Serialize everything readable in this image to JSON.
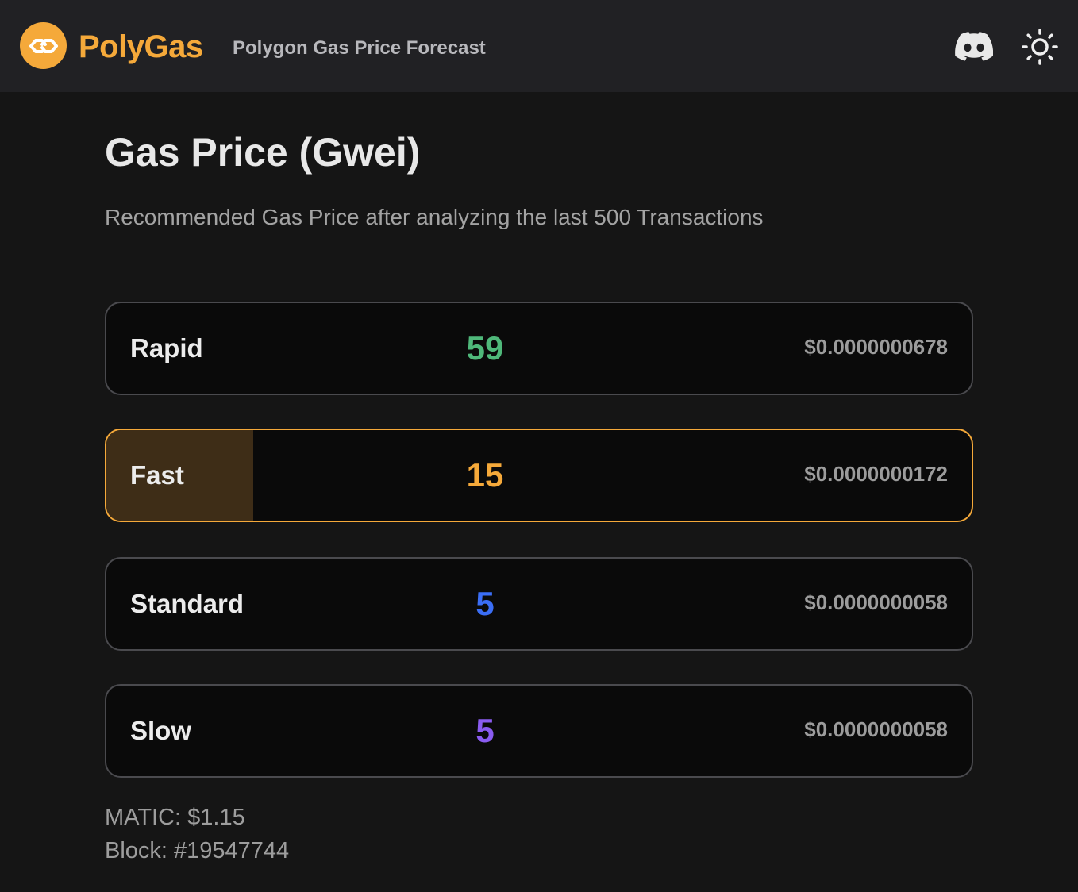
{
  "header": {
    "brand": "PolyGas",
    "tagline": "Polygon Gas Price Forecast",
    "brand_color": "#f5a93a",
    "icons": [
      "polygon-logo-icon",
      "discord-icon",
      "sun-icon"
    ]
  },
  "main": {
    "title": "Gas Price (Gwei)",
    "subtitle": "Recommended Gas Price after analyzing the last 500 Transactions"
  },
  "tiers": [
    {
      "label": "Rapid",
      "gwei": "59",
      "usd": "$0.0000000678",
      "color": "#4fb87a",
      "selected": false
    },
    {
      "label": "Fast",
      "gwei": "15",
      "usd": "$0.0000000172",
      "color": "#f5a93a",
      "selected": true,
      "progress": 0.17
    },
    {
      "label": "Standard",
      "gwei": "5",
      "usd": "$0.0000000058",
      "color": "#3b6ef5",
      "selected": false
    },
    {
      "label": "Slow",
      "gwei": "5",
      "usd": "$0.0000000058",
      "color": "#8a5cf0",
      "selected": false
    }
  ],
  "footer": {
    "matic": "MATIC: $1.15",
    "block": "Block: #19547744"
  }
}
